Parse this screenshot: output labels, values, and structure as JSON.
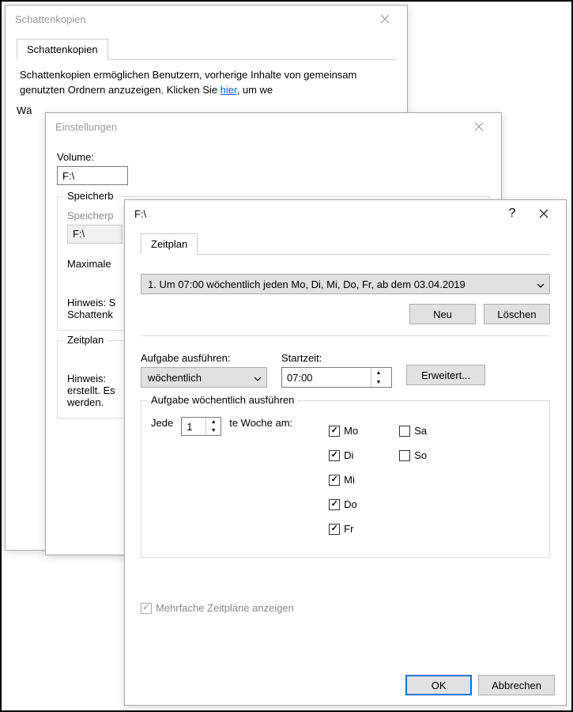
{
  "dlg1": {
    "title": "Schattenkopien",
    "tab": "Schattenkopien",
    "description_part1": "Schattenkopien ermöglichen Benutzern, vorherige Inhalte von gemeinsam genutzten Ordnern anzuzeigen. Klicken Sie ",
    "description_link": "hier",
    "description_part2": ", um we",
    "select_label": "Wä"
  },
  "dlg2": {
    "title": "Einstellungen",
    "volume_label": "Volume:",
    "volume_value": "F:\\",
    "group_storage": "Speicherb",
    "storage_label": "Speicherp",
    "storage_value": "F:\\",
    "max_label": "Maximale",
    "hint1": "Hinweis: S",
    "hint1_line2": "Schattenk",
    "group_schedule": "Zeitplan",
    "hint2_line1": "Hinweis:",
    "hint2_line2": "erstellt. Es",
    "hint2_line3": "werden."
  },
  "dlg3": {
    "title": "F:\\",
    "tab": "Zeitplan",
    "schedule_summary": "1. Um 07:00 wöchentlich jeden Mo, Di, Mi, Do, Fr, ab dem 03.04.2019",
    "btn_new": "Neu",
    "btn_delete": "Löschen",
    "task_label": "Aufgabe ausführen:",
    "task_value": "wöchentlich",
    "start_label": "Startzeit:",
    "start_value": "07:00",
    "btn_advanced": "Erweitert...",
    "group_weekly": "Aufgabe wöchentlich ausführen",
    "every_prefix": "Jede",
    "every_value": "1",
    "every_suffix": "te Woche am:",
    "days": {
      "mo": "Mo",
      "di": "Di",
      "mi": "Mi",
      "do": "Do",
      "fr": "Fr",
      "sa": "Sa",
      "so": "So"
    },
    "multi_schedules": "Mehrfache Zeitpläne anzeigen",
    "btn_ok": "OK",
    "btn_cancel": "Abbrechen"
  }
}
